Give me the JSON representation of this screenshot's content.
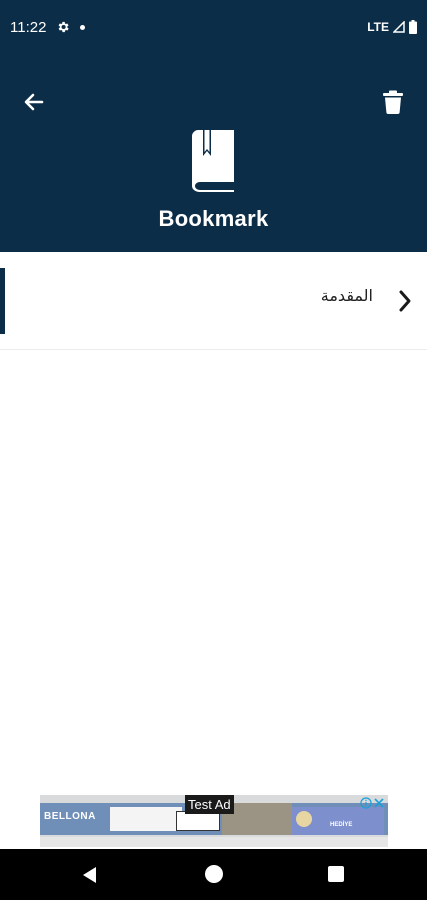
{
  "status_bar": {
    "time": "11:22",
    "network": "LTE",
    "icons": [
      "settings-icon",
      "notification-dot-icon",
      "signal-icon",
      "battery-icon"
    ]
  },
  "header": {
    "title": "Bookmark",
    "background_color": "#0c2d48",
    "icons": [
      "back-arrow-icon",
      "trash-icon",
      "book-bookmark-icon"
    ]
  },
  "bookmarks": {
    "items": [
      {
        "label": "المقدمة",
        "icon": "chevron-right-icon"
      }
    ]
  },
  "ad": {
    "label": "Test Ad",
    "brand": "BELLONA",
    "cta": "HEDİYE",
    "icons": [
      "ad-info-icon",
      "ad-close-icon"
    ]
  },
  "nav_bar": {
    "icons": [
      "nav-back-icon",
      "nav-home-icon",
      "nav-recent-icon"
    ]
  }
}
